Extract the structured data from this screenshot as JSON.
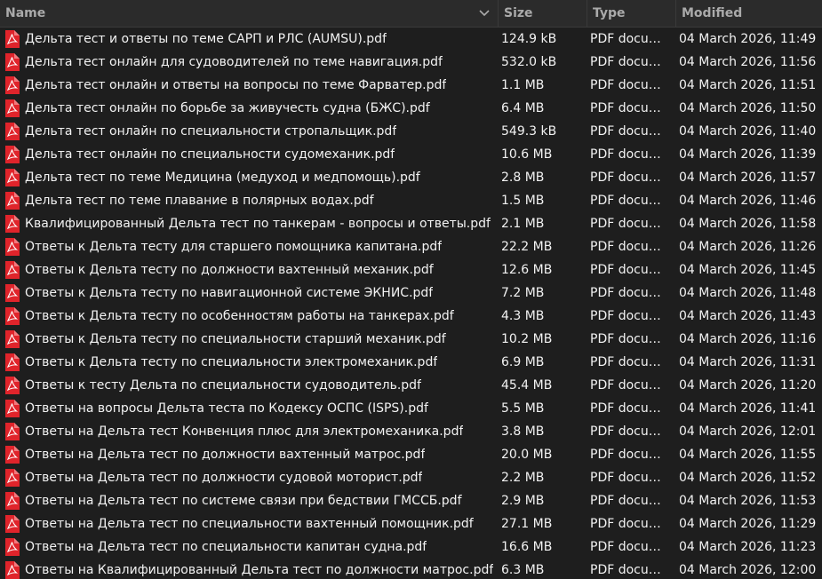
{
  "columns": {
    "name": "Name",
    "size": "Size",
    "type": "Type",
    "modified": "Modified"
  },
  "icons": {
    "file": "pdf-file-icon",
    "sort": "chevron-down-icon"
  },
  "colors": {
    "pdf_icon": "#e0242b",
    "background": "#1e1e1e",
    "header": "#2b2b2b"
  },
  "files": [
    {
      "name": "Дельта тест и ответы по теме САРП и РЛС (AUMSU).pdf",
      "size": "124.9 kB",
      "type": "PDF docum…",
      "modified": "04 March 2026, 11:49"
    },
    {
      "name": "Дельта тест онлайн для судоводителей по теме навигация.pdf",
      "size": "532.0 kB",
      "type": "PDF docum…",
      "modified": "04 March 2026, 11:56"
    },
    {
      "name": "Дельта тест онлайн и ответы на вопросы по теме Фарватер.pdf",
      "size": "1.1 MB",
      "type": "PDF docum…",
      "modified": "04 March 2026, 11:51"
    },
    {
      "name": "Дельта тест онлайн по борьбе за живучесть судна (БЖС).pdf",
      "size": "6.4 MB",
      "type": "PDF docum…",
      "modified": "04 March 2026, 11:50"
    },
    {
      "name": "Дельта тест онлайн по специальности стропальщик.pdf",
      "size": "549.3 kB",
      "type": "PDF docum…",
      "modified": "04 March 2026, 11:40"
    },
    {
      "name": "Дельта тест онлайн по специальности судомеханик.pdf",
      "size": "10.6 MB",
      "type": "PDF docum…",
      "modified": "04 March 2026, 11:39"
    },
    {
      "name": "Дельта тест по теме Медицина (медуход и медпомощь).pdf",
      "size": "2.8 MB",
      "type": "PDF docum…",
      "modified": "04 March 2026, 11:57"
    },
    {
      "name": "Дельта тест по теме плавание в полярных водах.pdf",
      "size": "1.5 MB",
      "type": "PDF docum…",
      "modified": "04 March 2026, 11:46"
    },
    {
      "name": "Квалифицированный Дельта тест по танкерам - вопросы и ответы.pdf",
      "size": "2.1 MB",
      "type": "PDF docum…",
      "modified": "04 March 2026, 11:58"
    },
    {
      "name": "Ответы к Дельта тесту для старшего помощника капитана.pdf",
      "size": "22.2 MB",
      "type": "PDF docum…",
      "modified": "04 March 2026, 11:26"
    },
    {
      "name": "Ответы к Дельта тесту по должности вахтенный механик.pdf",
      "size": "12.6 MB",
      "type": "PDF docum…",
      "modified": "04 March 2026, 11:45"
    },
    {
      "name": "Ответы к Дельта тесту по навигационной системе ЭКНИС.pdf",
      "size": "7.2 MB",
      "type": "PDF docum…",
      "modified": "04 March 2026, 11:48"
    },
    {
      "name": "Ответы к Дельта тесту по особенностям работы на танкерах.pdf",
      "size": "4.3 MB",
      "type": "PDF docum…",
      "modified": "04 March 2026, 11:43"
    },
    {
      "name": "Ответы к Дельта тесту по специальности старший механик.pdf",
      "size": "10.2 MB",
      "type": "PDF docum…",
      "modified": "04 March 2026, 11:16"
    },
    {
      "name": "Ответы к Дельта тесту по специальности электромеханик.pdf",
      "size": "6.9 MB",
      "type": "PDF docum…",
      "modified": "04 March 2026, 11:31"
    },
    {
      "name": "Ответы к тесту Дельта по специальности судоводитель.pdf",
      "size": "45.4 MB",
      "type": "PDF docum…",
      "modified": "04 March 2026, 11:20"
    },
    {
      "name": "Ответы на вопросы Дельта теста по Кодексу ОСПС (ISPS).pdf",
      "size": "5.5 MB",
      "type": "PDF docum…",
      "modified": "04 March 2026, 11:41"
    },
    {
      "name": "Ответы на Дельта тест Конвенция плюс для электромеханика.pdf",
      "size": "3.8 MB",
      "type": "PDF docum…",
      "modified": "04 March 2026, 12:01"
    },
    {
      "name": "Ответы на Дельта тест по должности вахтенный матрос.pdf",
      "size": "20.0 MB",
      "type": "PDF docum…",
      "modified": "04 March 2026, 11:55"
    },
    {
      "name": "Ответы на Дельта тест по должности судовой моторист.pdf",
      "size": "2.2 MB",
      "type": "PDF docum…",
      "modified": "04 March 2026, 11:52"
    },
    {
      "name": "Ответы на Дельта тест по системе связи при бедствии ГМССБ.pdf",
      "size": "2.9 MB",
      "type": "PDF docum…",
      "modified": "04 March 2026, 11:53"
    },
    {
      "name": "Ответы на Дельта тест по специальности вахтенный помощник.pdf",
      "size": "27.1 MB",
      "type": "PDF docum…",
      "modified": "04 March 2026, 11:29"
    },
    {
      "name": "Ответы на Дельта тест по специальности капитан судна.pdf",
      "size": "16.6 MB",
      "type": "PDF docum…",
      "modified": "04 March 2026, 11:23"
    },
    {
      "name": "Ответы на Квалифицированный Дельта тест по должности матрос.pdf",
      "size": "6.3 MB",
      "type": "PDF docum…",
      "modified": "04 March 2026, 12:00"
    }
  ]
}
